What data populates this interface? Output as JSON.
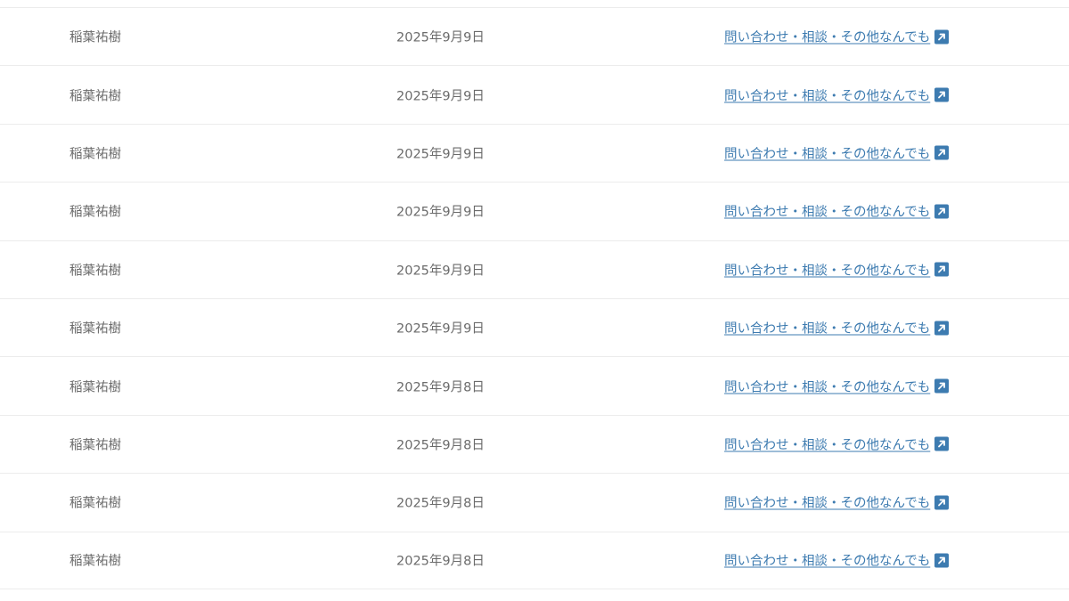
{
  "rows": [
    {
      "name": "稲葉祐樹",
      "date": "2025年9月9日",
      "link": "問い合わせ・相談・その他なんでも",
      "icon": "external-link-icon"
    },
    {
      "name": "稲葉祐樹",
      "date": "2025年9月9日",
      "link": "問い合わせ・相談・その他なんでも",
      "icon": "external-link-icon"
    },
    {
      "name": "稲葉祐樹",
      "date": "2025年9月9日",
      "link": "問い合わせ・相談・その他なんでも",
      "icon": "external-link-icon"
    },
    {
      "name": "稲葉祐樹",
      "date": "2025年9月9日",
      "link": "問い合わせ・相談・その他なんでも",
      "icon": "external-link-icon"
    },
    {
      "name": "稲葉祐樹",
      "date": "2025年9月9日",
      "link": "問い合わせ・相談・その他なんでも",
      "icon": "external-link-icon"
    },
    {
      "name": "稲葉祐樹",
      "date": "2025年9月9日",
      "link": "問い合わせ・相談・その他なんでも",
      "icon": "external-link-icon"
    },
    {
      "name": "稲葉祐樹",
      "date": "2025年9月8日",
      "link": "問い合わせ・相談・その他なんでも",
      "icon": "external-link-icon"
    },
    {
      "name": "稲葉祐樹",
      "date": "2025年9月8日",
      "link": "問い合わせ・相談・その他なんでも",
      "icon": "external-link-icon"
    },
    {
      "name": "稲葉祐樹",
      "date": "2025年9月8日",
      "link": "問い合わせ・相談・その他なんでも",
      "icon": "external-link-icon"
    },
    {
      "name": "稲葉祐樹",
      "date": "2025年9月8日",
      "link": "問い合わせ・相談・その他なんでも",
      "icon": "external-link-icon"
    }
  ],
  "colors": {
    "text": "#6b6b6b",
    "link": "#3d7bb0",
    "divider": "#ececec"
  }
}
